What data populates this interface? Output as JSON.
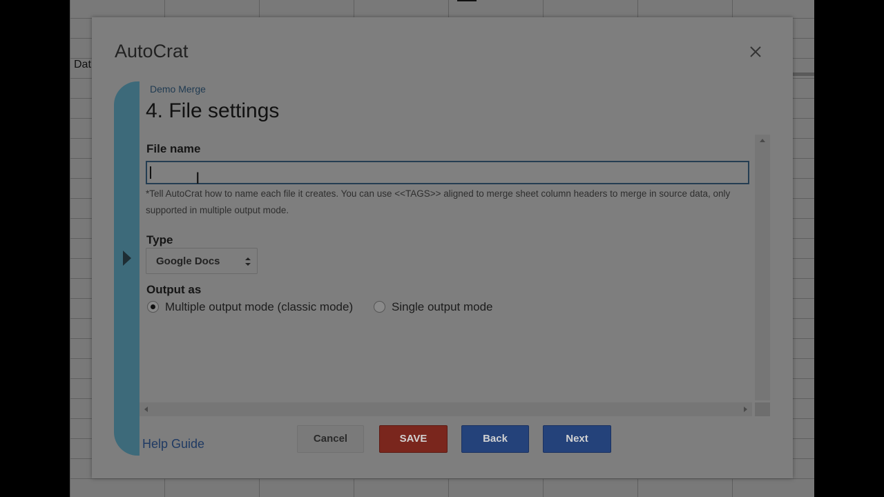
{
  "spreadsheet": {
    "cell_text": "Dat"
  },
  "dialog": {
    "title": "AutoCrat",
    "close_icon": "close-icon",
    "merge_name": "Demo Merge",
    "step_title": "4. File settings"
  },
  "file_name": {
    "label": "File name",
    "value": "",
    "help_text": "*Tell AutoCrat how to name each file it creates. You can use <<TAGS>> aligned to merge sheet column headers to merge in source data, only supported in multiple output mode."
  },
  "type": {
    "label": "Type",
    "selected": "Google Docs"
  },
  "output": {
    "label": "Output as",
    "options": [
      {
        "label": "Multiple output mode (classic mode)",
        "selected": true
      },
      {
        "label": "Single output mode",
        "selected": false
      }
    ]
  },
  "footer": {
    "help_link": "Help Guide",
    "cancel_label": "Cancel",
    "save_label": "SAVE",
    "back_label": "Back",
    "next_label": "Next"
  },
  "colors": {
    "accent_stripe": "#3d6a7a",
    "save_button": "#7a261d",
    "primary_button": "#24427a"
  }
}
